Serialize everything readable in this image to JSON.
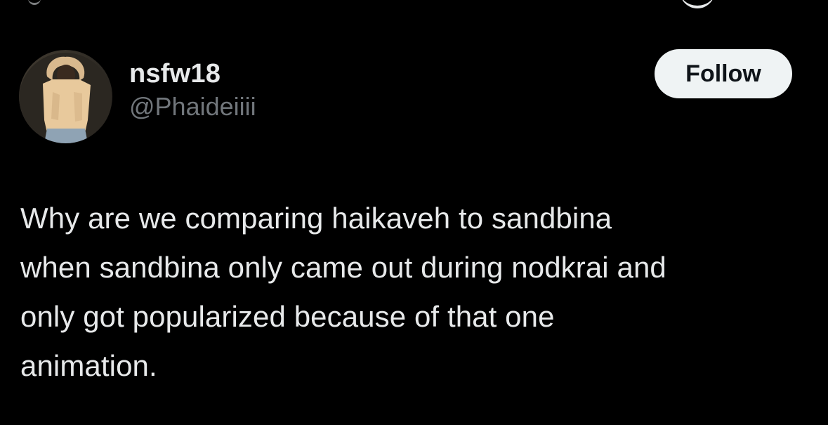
{
  "colors": {
    "background": "#000000",
    "primary_text": "#e7e9ea",
    "secondary_text": "#71767b",
    "follow_button_bg": "#eff3f4",
    "follow_button_text": "#0f1419"
  },
  "author": {
    "display_name": "nsfw18",
    "handle": "@Phaideiiii",
    "avatar_icon": "user-avatar-photo"
  },
  "actions": {
    "follow_label": "Follow"
  },
  "tweet": {
    "lines": [
      "Why are we comparing haikaveh to sandbina",
      "when sandbina only came out during nodkrai and",
      "only got popularized because of that one",
      "animation."
    ]
  }
}
